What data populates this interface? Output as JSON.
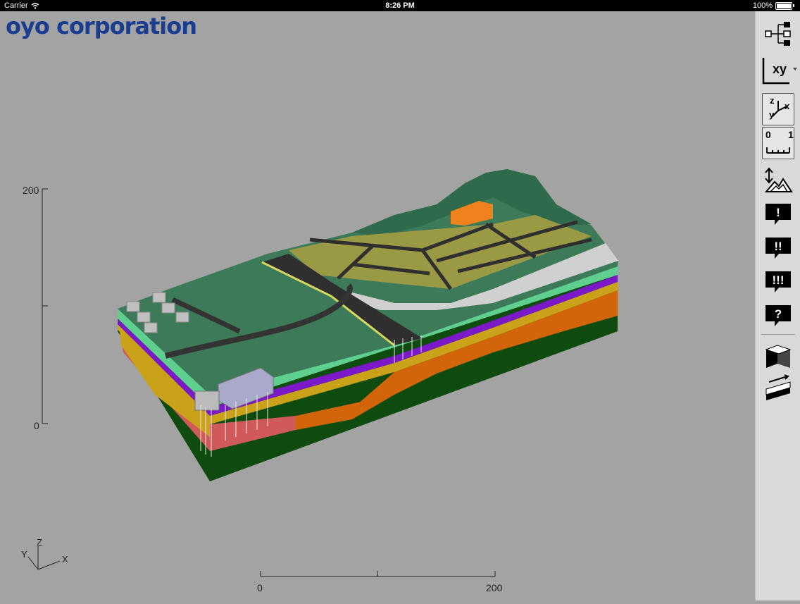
{
  "status_bar": {
    "carrier": "Carrier",
    "time": "8:26 PM",
    "battery": "100%"
  },
  "logo": {
    "text": "oyo corporation"
  },
  "scale": {
    "z_max": "200",
    "z_min": "0",
    "x_min": "0",
    "x_max": "200"
  },
  "axes": {
    "z": "Z",
    "y": "Y",
    "x": "X"
  },
  "toolbar": {
    "view_xy_label": "xy",
    "axis_labels": {
      "z": "z",
      "x": "x",
      "y": "y"
    },
    "ruler_labels": {
      "min": "0",
      "max": "1"
    },
    "exclaim_1": "!",
    "exclaim_2": "!!",
    "exclaim_3": "!!!",
    "question": "?"
  },
  "colors": {
    "background": "#a3a3a3",
    "logo": "#1a3d8f",
    "terrain_green": "#3d7a5a",
    "field_olive": "#9a9a45",
    "road": "#3a3a3a",
    "layer_orange": "#d2650a",
    "layer_dark": "#0f4a0f",
    "layer_purple": "#7b18c8",
    "layer_pink": "#d05a5a",
    "layer_mint": "#5fcf8f"
  }
}
